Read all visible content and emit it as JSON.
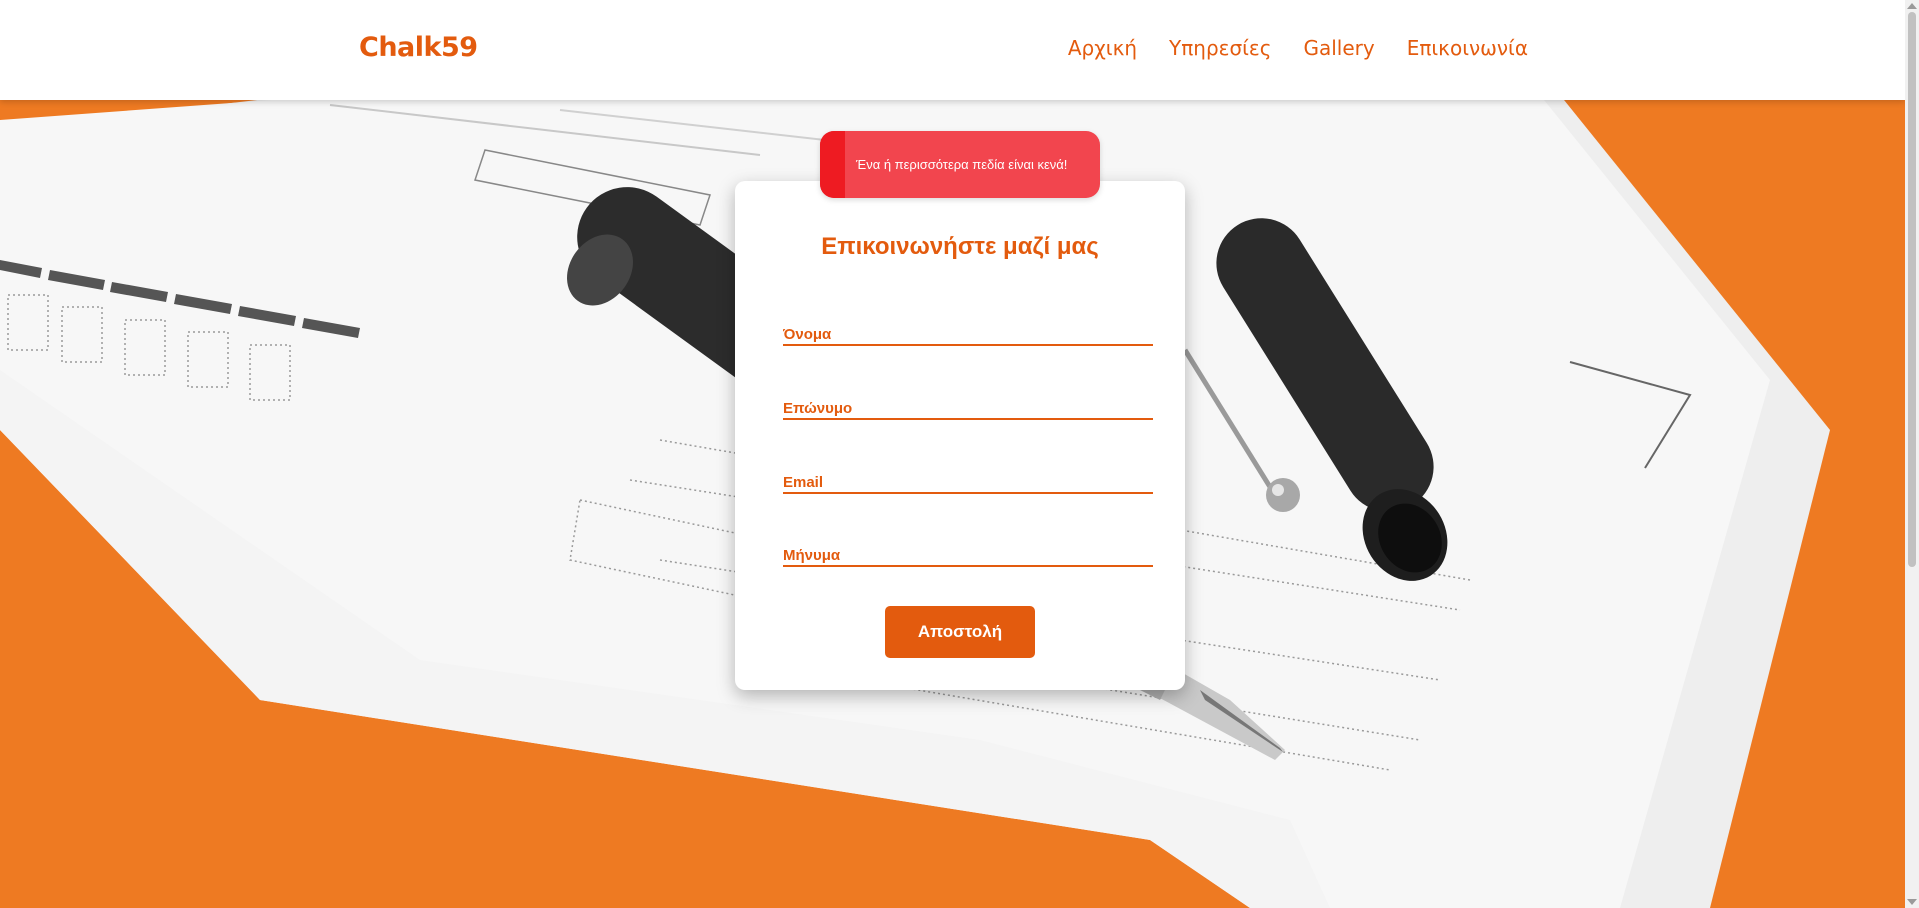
{
  "navbar": {
    "brand": "Chalk59",
    "links": [
      "Αρχική",
      "Υπηρεσίες",
      "Gallery",
      "Επικοινωνία"
    ]
  },
  "toast": {
    "message": "Ένα ή περισσότερα πεδία είναι κενά!"
  },
  "form": {
    "title": "Επικοινωνήστε μαζί μας",
    "fields": {
      "first_name": "Όνομα",
      "last_name": "Επώνυμο",
      "email": "Email",
      "message": "Μήνυμα"
    },
    "submit_label": "Αποστολή"
  },
  "colors": {
    "accent": "#e35b0e",
    "background": "#ee7a22",
    "toast": "#f2454e",
    "toast_bar": "#ee1b22"
  }
}
